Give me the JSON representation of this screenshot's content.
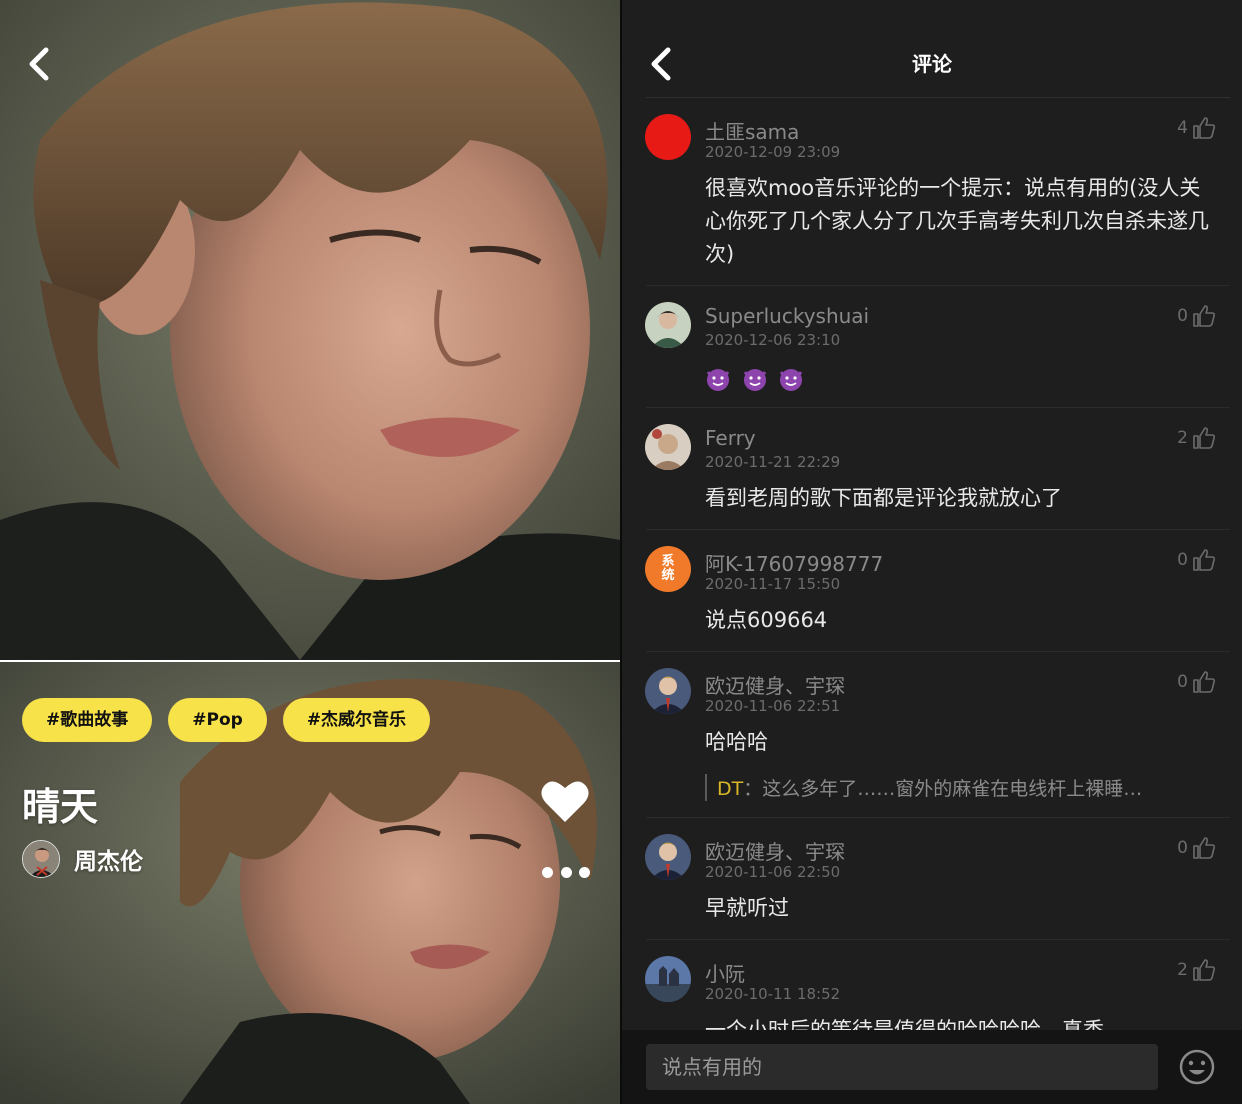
{
  "player": {
    "tags": [
      "#歌曲故事",
      "#Pop",
      "#杰威尔音乐"
    ],
    "song_title": "晴天",
    "artist": "周杰伦"
  },
  "comments_page": {
    "title": "评论",
    "comments": [
      {
        "username": "土匪sama",
        "date": "2020-12-09 23:09",
        "likes": "4",
        "text": "很喜欢moo音乐评论的一个提示：说点有用的(没人关心你死了几个家人分了几次手高考失利几次自杀未遂几次)",
        "avatar": "red-circle"
      },
      {
        "username": "Superluckyshuai",
        "date": "2020-12-06 23:10",
        "likes": "0",
        "text": "",
        "emoji_count": 3,
        "avatar": "photo-woman"
      },
      {
        "username": "Ferry",
        "date": "2020-11-21 22:29",
        "likes": "2",
        "text": "看到老周的歌下面都是评论我就放心了",
        "avatar": "photo-beige"
      },
      {
        "username": "阿K-17607998777",
        "date": "2020-11-17 15:50",
        "likes": "0",
        "text": "说点609664",
        "avatar": "system-badge",
        "avatar_text": "系统"
      },
      {
        "username": "欧迈健身、宇琛",
        "date": "2020-11-06 22:51",
        "likes": "0",
        "text": "哈哈哈",
        "reply_name": "DT",
        "reply_text": "：这么多年了……窗外的麻雀在电线杆上裸睡…",
        "avatar": "photo-man"
      },
      {
        "username": "欧迈健身、宇琛",
        "date": "2020-11-06 22:50",
        "likes": "0",
        "text": "早就听过",
        "avatar": "photo-man"
      },
      {
        "username": "小阮",
        "date": "2020-10-11 18:52",
        "likes": "2",
        "text": "一个小时后的等待是值得的哈哈哈哈，真香",
        "avatar": "photo-castle"
      }
    ],
    "input_placeholder": "说点有用的"
  },
  "colors": {
    "accent_yellow": "#f7e24a",
    "bg_dark": "#1e1e1e"
  }
}
